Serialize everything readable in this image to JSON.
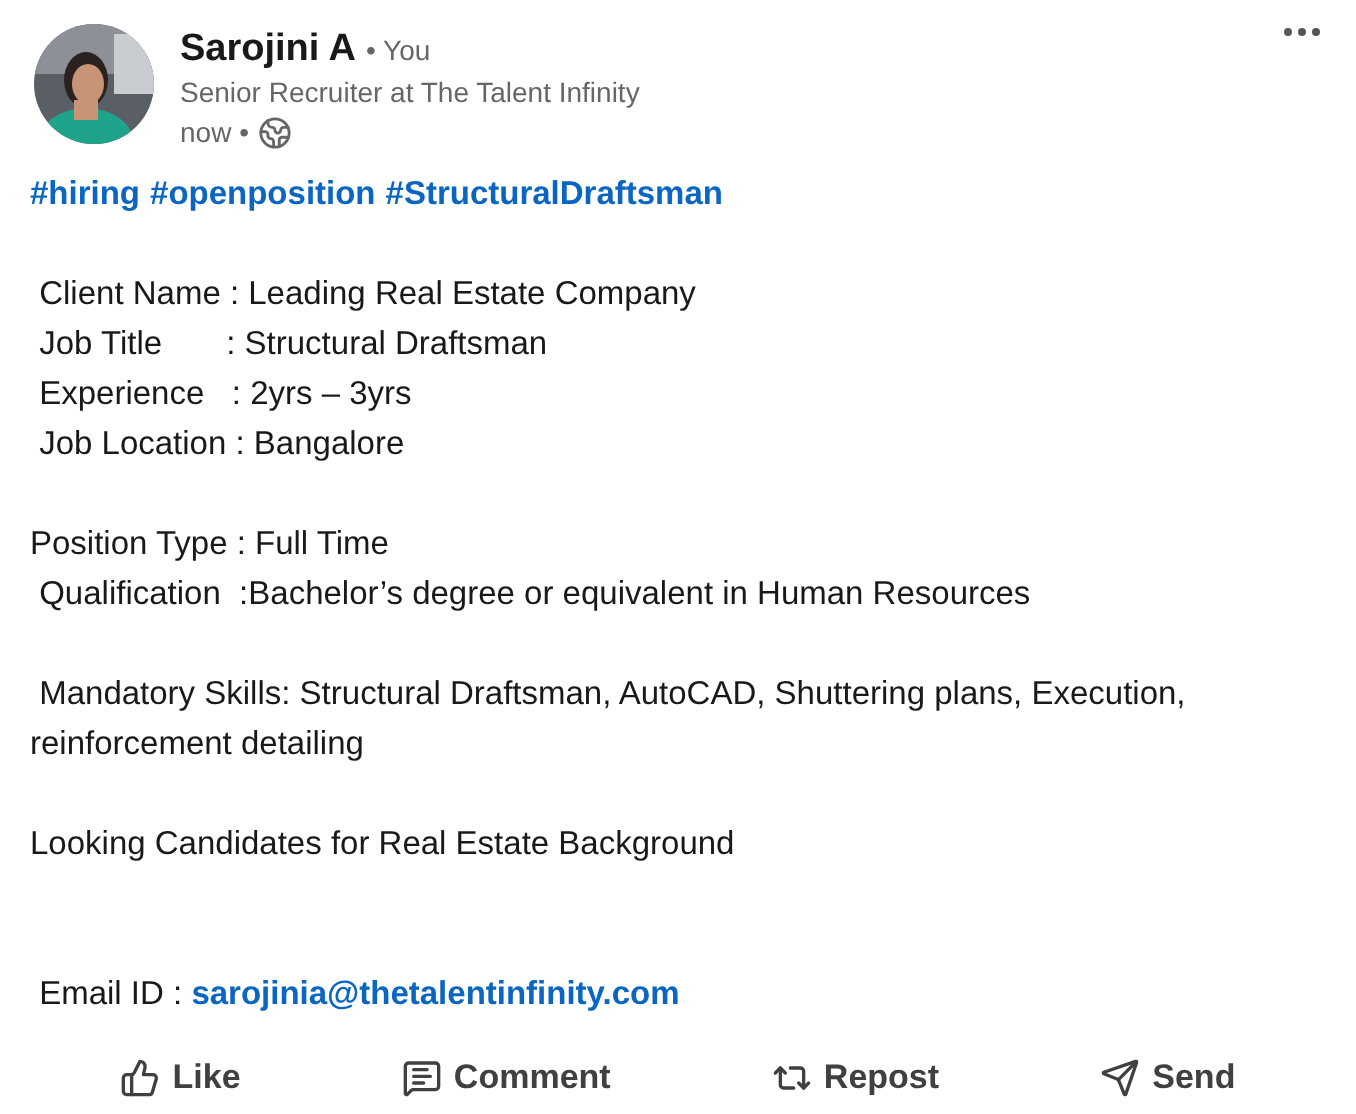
{
  "author": {
    "name": "Sarojini A",
    "relation": "• You",
    "headline": "Senior Recruiter at The Talent Infinity",
    "time": "now •"
  },
  "hashtags": [
    "#hiring",
    "#openposition",
    "#StructuralDraftsman"
  ],
  "blocks": [
    [
      " Client Name : Leading Real Estate Company",
      " Job Title       : Structural Draftsman",
      " Experience   : 2yrs – 3yrs",
      " Job Location : Bangalore"
    ],
    [
      "Position Type : Full Time",
      " Qualification  :Bachelor’s degree or equivalent in Human Resources"
    ],
    [
      " Mandatory Skills: Structural Draftsman, AutoCAD, Shuttering plans, Execution, reinforcement detailing"
    ],
    [
      "Looking Candidates for Real Estate Background"
    ]
  ],
  "email": {
    "label": " Email ID : ",
    "address": "sarojinia@thetalentinfinity.com"
  },
  "actions": [
    {
      "kind": "like",
      "label": "Like"
    },
    {
      "kind": "comment",
      "label": "Comment"
    },
    {
      "kind": "repost",
      "label": "Repost"
    },
    {
      "kind": "send",
      "label": "Send"
    }
  ]
}
